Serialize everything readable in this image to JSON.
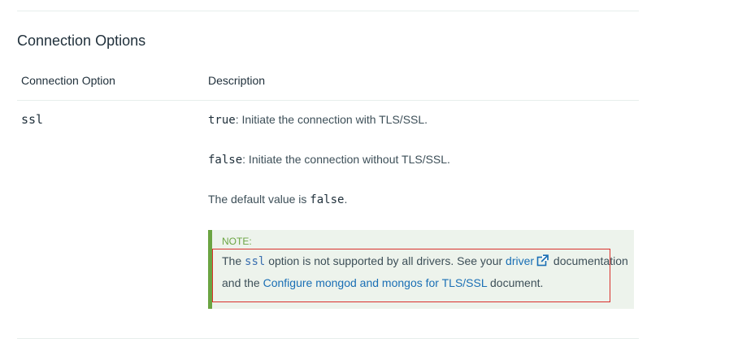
{
  "section": {
    "title": "Connection Options"
  },
  "table": {
    "headers": {
      "option": "Connection Option",
      "description": "Description"
    },
    "rows": [
      {
        "option": "ssl",
        "desc_true_code": "true",
        "desc_true_text": ": Initiate the connection with TLS/SSL.",
        "desc_false_code": "false",
        "desc_false_text": ": Initiate the connection without TLS/SSL.",
        "default_prefix": "The default value is ",
        "default_code": "false",
        "default_suffix": "."
      }
    ]
  },
  "note": {
    "label": "NOTE:",
    "text_1": "The ",
    "code": "ssl",
    "text_2": " option is not supported by all drivers. See your ",
    "driver_link": "driver",
    "external_icon": "external-link-icon",
    "text_3": " documentation and the ",
    "configure_link": "Configure mongod and mongos for TLS/SSL",
    "text_4": " document."
  },
  "colors": {
    "note_accent": "#6ba442",
    "note_background": "#edf3ec",
    "link": "#1a6fb5",
    "highlight": "#d9302c"
  }
}
